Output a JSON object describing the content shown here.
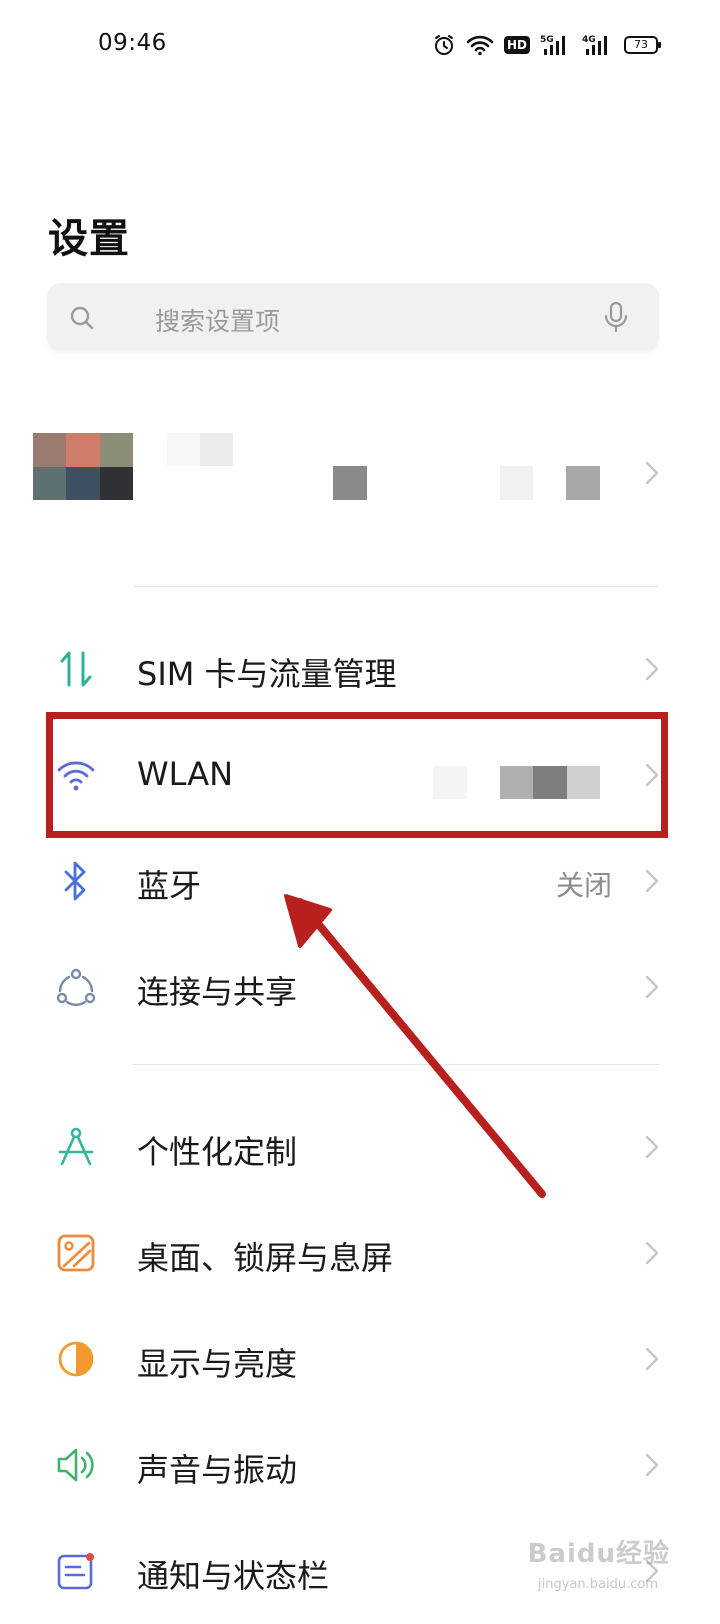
{
  "status_bar": {
    "time": "09:46",
    "icons": [
      "alarm-icon",
      "wifi-icon",
      "hd-icon",
      "signal-5g-icon",
      "signal-4g-icon",
      "battery-icon"
    ],
    "hd_label": "HD",
    "net_5g": "5G",
    "net_4g": "4G",
    "battery_level": "73"
  },
  "header": {
    "title": "设置"
  },
  "search": {
    "placeholder": "搜索设置项",
    "icon": "search-icon",
    "trailing_icon": "microphone-icon"
  },
  "account": {
    "avatar_colors": [
      "#9b7a70",
      "#cf7c6a",
      "#8d8c76",
      "#5f7072",
      "#3f5063",
      "#2f3235"
    ]
  },
  "settings_groups": [
    {
      "items": [
        {
          "label": "SIM 卡与流量管理",
          "icon": "data-transfer-icon",
          "icon_color": "#2bb39a",
          "value": ""
        },
        {
          "label": "WLAN",
          "icon": "wifi-icon",
          "icon_color": "#5b6bd6",
          "value": ""
        },
        {
          "label": "蓝牙",
          "icon": "bluetooth-icon",
          "icon_color": "#4a6fd6",
          "value": "关闭"
        },
        {
          "label": "连接与共享",
          "icon": "connection-sharing-icon",
          "icon_color": "#7a8aa6",
          "value": ""
        }
      ]
    },
    {
      "items": [
        {
          "label": "个性化定制",
          "icon": "personalization-icon",
          "icon_color": "#35b59a",
          "value": ""
        },
        {
          "label": "桌面、锁屏与息屏",
          "icon": "wallpaper-icon",
          "icon_color": "#ef8a3c",
          "value": ""
        },
        {
          "label": "显示与亮度",
          "icon": "brightness-icon",
          "icon_color": "#f29a2e",
          "value": ""
        },
        {
          "label": "声音与振动",
          "icon": "sound-icon",
          "icon_color": "#3fb36a",
          "value": ""
        },
        {
          "label": "通知与状态栏",
          "icon": "notification-icon",
          "icon_color": "#5a6ad6",
          "value": ""
        }
      ]
    }
  ],
  "annotation": {
    "color": "#b8201e",
    "highlighted_item": "WLAN"
  },
  "watermark": {
    "text": "Baidu经验",
    "sub": "jingyan.baidu.com"
  }
}
